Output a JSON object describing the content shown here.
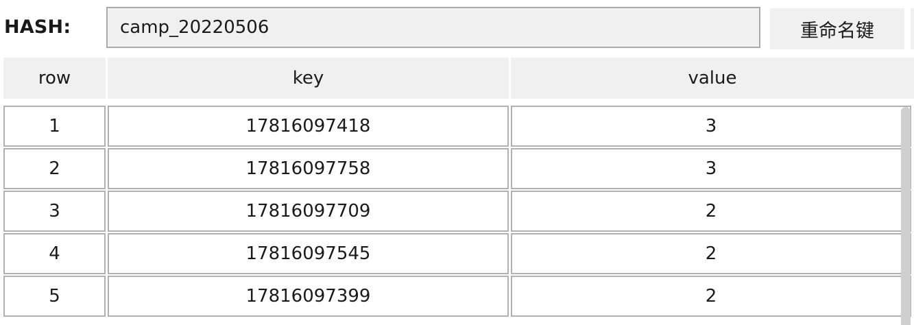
{
  "header": {
    "hash_label": "HASH:",
    "key_name": "camp_20220506",
    "rename_button": "重命名键"
  },
  "table": {
    "columns": [
      "row",
      "key",
      "value"
    ],
    "rows": [
      {
        "row": "1",
        "key": "17816097418",
        "value": "3"
      },
      {
        "row": "2",
        "key": "17816097758",
        "value": "3"
      },
      {
        "row": "3",
        "key": "17816097709",
        "value": "2"
      },
      {
        "row": "4",
        "key": "17816097545",
        "value": "2"
      },
      {
        "row": "5",
        "key": "17816097399",
        "value": "2"
      }
    ]
  }
}
